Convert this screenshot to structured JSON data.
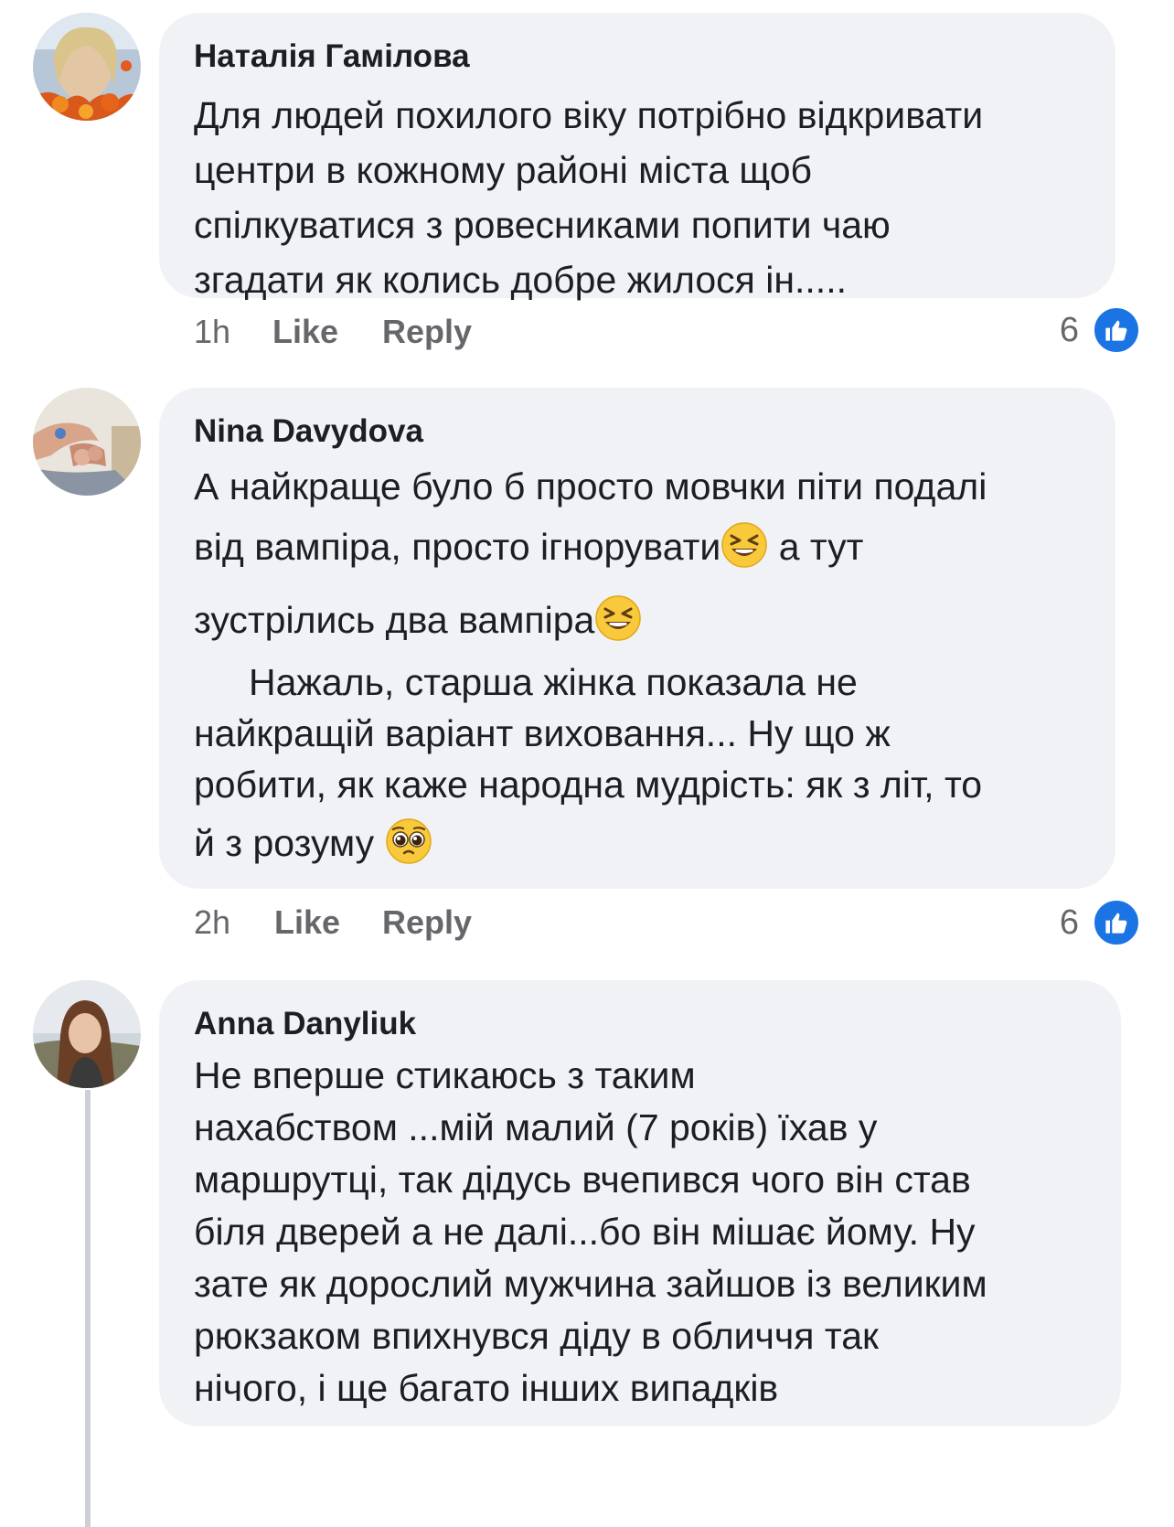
{
  "colors": {
    "bubble": "#f0f2f5",
    "like_blue": "#1b74e4",
    "meta_text": "#65676b"
  },
  "comments": [
    {
      "author": "Наталія Гамілова",
      "lines": [
        "Для людей похилого віку потрібно відкривати",
        "центри в кожному районі міста щоб",
        "спілкуватися з ровесниками попити чаю",
        "згадати як колись добре жилося ін....."
      ],
      "time": "1h",
      "like_label": "Like",
      "reply_label": "Reply",
      "reactions_count": "6",
      "reaction_icon": "like-icon"
    },
    {
      "author": "Nina Davydova",
      "lines": [
        "А найкраще було б просто мовчки піти подалі",
        "від вампіра, просто ігнорувати",
        " а тут",
        "зустрілись два вампіра",
        "Нажаль, старша жінка показала не",
        "найкращій варіант виховання... Ну що ж",
        "робити, як каже народна мудрість: як з літ, то",
        "й з розуму "
      ],
      "emojis": [
        "laughing-emoji",
        "laughing-emoji",
        "pleading-face-emoji"
      ],
      "time": "2h",
      "like_label": "Like",
      "reply_label": "Reply",
      "reactions_count": "6",
      "reaction_icon": "like-icon"
    },
    {
      "author": "Anna Danyliuk",
      "lines": [
        "Не вперше стикаюсь з таким",
        "нахабством ...мій малий (7 років) їхав у",
        "маршрутці, так дідусь вчепився чого він став",
        "біля дверей а не далі...бо він мішає йому. Ну",
        "зате як дорослий мужчина зайшов із великим",
        "рюкзаком впихнувся діду в обличчя так",
        "нічого, і ще багато інших випадків"
      ]
    }
  ]
}
